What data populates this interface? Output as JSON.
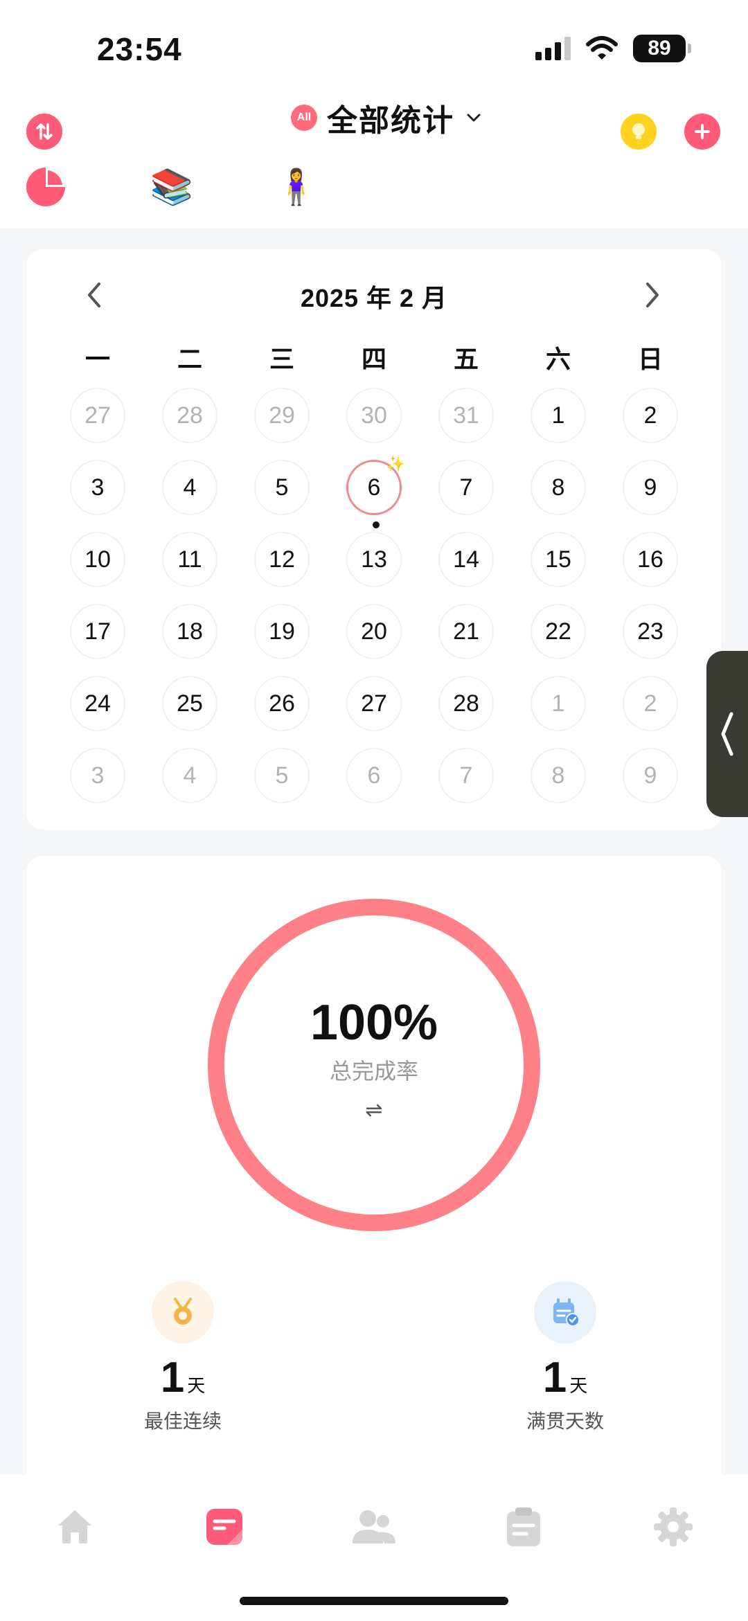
{
  "status_bar": {
    "time": "23:54",
    "battery": "89"
  },
  "header": {
    "badge": "All",
    "title": "全部统计",
    "tabs": [
      {
        "icon": "pie-chart-icon"
      },
      {
        "icon": "books-icon",
        "glyph": "📚"
      },
      {
        "icon": "person-icon",
        "glyph": "🧍‍♀️"
      }
    ]
  },
  "calendar": {
    "month_title": "2025 年 2 月",
    "weekdays": [
      "一",
      "二",
      "三",
      "四",
      "五",
      "六",
      "日"
    ],
    "weeks": [
      [
        {
          "d": "27",
          "m": true
        },
        {
          "d": "28",
          "m": true
        },
        {
          "d": "29",
          "m": true
        },
        {
          "d": "30",
          "m": true
        },
        {
          "d": "31",
          "m": true
        },
        {
          "d": "1"
        },
        {
          "d": "2"
        }
      ],
      [
        {
          "d": "3"
        },
        {
          "d": "4"
        },
        {
          "d": "5"
        },
        {
          "d": "6",
          "today": true
        },
        {
          "d": "7"
        },
        {
          "d": "8"
        },
        {
          "d": "9"
        }
      ],
      [
        {
          "d": "10"
        },
        {
          "d": "11"
        },
        {
          "d": "12"
        },
        {
          "d": "13"
        },
        {
          "d": "14"
        },
        {
          "d": "15"
        },
        {
          "d": "16"
        }
      ],
      [
        {
          "d": "17"
        },
        {
          "d": "18"
        },
        {
          "d": "19"
        },
        {
          "d": "20"
        },
        {
          "d": "21"
        },
        {
          "d": "22"
        },
        {
          "d": "23"
        }
      ],
      [
        {
          "d": "24"
        },
        {
          "d": "25"
        },
        {
          "d": "26"
        },
        {
          "d": "27"
        },
        {
          "d": "28"
        },
        {
          "d": "1",
          "m": true
        },
        {
          "d": "2",
          "m": true
        }
      ],
      [
        {
          "d": "3",
          "m": true
        },
        {
          "d": "4",
          "m": true
        },
        {
          "d": "5",
          "m": true
        },
        {
          "d": "6",
          "m": true
        },
        {
          "d": "7",
          "m": true
        },
        {
          "d": "8",
          "m": true
        },
        {
          "d": "9",
          "m": true
        }
      ]
    ]
  },
  "stats": {
    "completion": {
      "value": "100%",
      "label": "总完成率",
      "fraction": 1.0,
      "swap": "⇌"
    },
    "best_streak": {
      "num": "1",
      "unit": "天",
      "label": "最佳连续"
    },
    "full_days": {
      "num": "1",
      "unit": "天",
      "label": "满贯天数"
    }
  },
  "colors": {
    "accent": "#ff5a78",
    "ring": "#ff8086",
    "bulb": "#ffd21f",
    "medal": "#f6b54a",
    "calendar_icon": "#7db5f0"
  },
  "bottom_nav": [
    "home-icon",
    "stats-icon",
    "people-icon",
    "clipboard-icon",
    "gear-icon"
  ]
}
